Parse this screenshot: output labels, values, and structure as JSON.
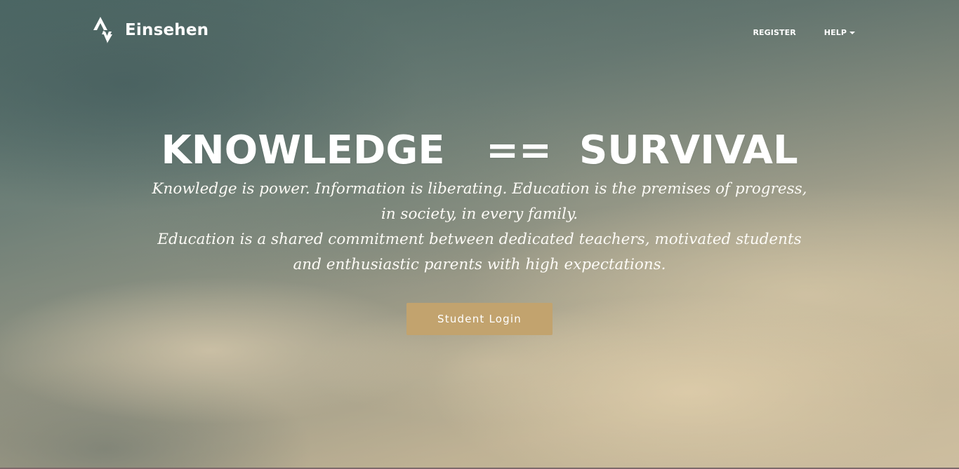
{
  "brand": {
    "name": "Einsehen",
    "icon": "strava-chevron-logo-icon"
  },
  "nav": {
    "register_label": "REGISTER",
    "help_label": "HELP",
    "help_icon": "caret-down-icon"
  },
  "hero": {
    "headline": "KNOWLEDGE   ==  SURVIVAL",
    "tagline_lines": [
      "Knowledge is power. Information is liberating. Education is the premises of progress,",
      "in society, in every family.",
      "Education is a shared commitment between dedicated teachers, motivated students",
      "and enthusiastic parents with high expectations."
    ],
    "cta_label": "Student Login"
  },
  "colors": {
    "accent": "#c2a36e",
    "text": "#ffffff"
  }
}
